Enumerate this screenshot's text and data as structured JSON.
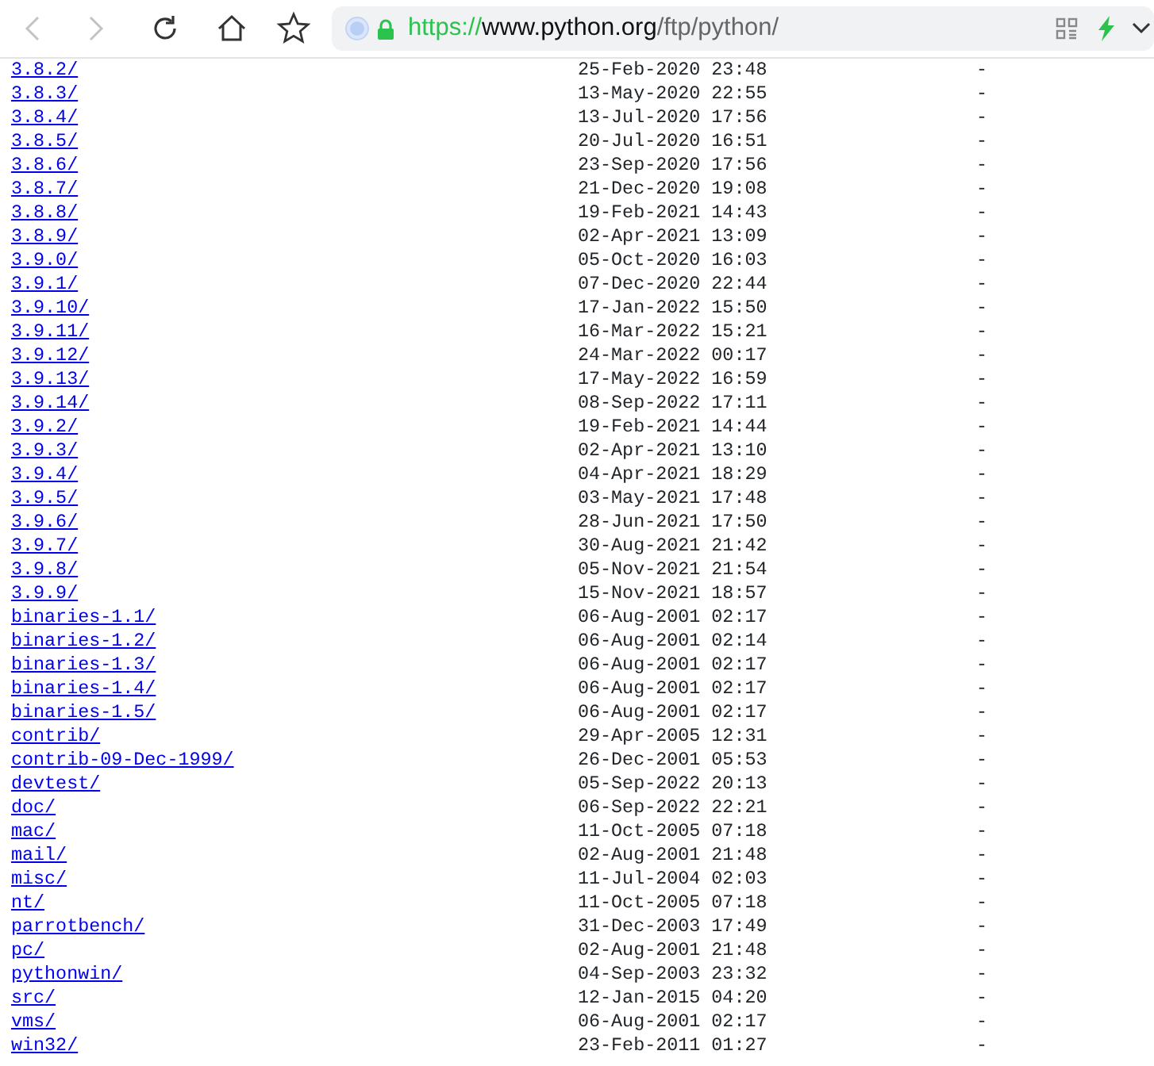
{
  "toolbar": {
    "back_disabled": true,
    "forward_disabled": true
  },
  "address_bar": {
    "scheme": "https://",
    "host": "www.python.org",
    "path": "/ftp/python/"
  },
  "entries": [
    {
      "name": "3.8.2/",
      "modified": "25-Feb-2020 23:48",
      "size": "-"
    },
    {
      "name": "3.8.3/",
      "modified": "13-May-2020 22:55",
      "size": "-"
    },
    {
      "name": "3.8.4/",
      "modified": "13-Jul-2020 17:56",
      "size": "-"
    },
    {
      "name": "3.8.5/",
      "modified": "20-Jul-2020 16:51",
      "size": "-"
    },
    {
      "name": "3.8.6/",
      "modified": "23-Sep-2020 17:56",
      "size": "-"
    },
    {
      "name": "3.8.7/",
      "modified": "21-Dec-2020 19:08",
      "size": "-"
    },
    {
      "name": "3.8.8/",
      "modified": "19-Feb-2021 14:43",
      "size": "-"
    },
    {
      "name": "3.8.9/",
      "modified": "02-Apr-2021 13:09",
      "size": "-"
    },
    {
      "name": "3.9.0/",
      "modified": "05-Oct-2020 16:03",
      "size": "-"
    },
    {
      "name": "3.9.1/",
      "modified": "07-Dec-2020 22:44",
      "size": "-"
    },
    {
      "name": "3.9.10/",
      "modified": "17-Jan-2022 15:50",
      "size": "-"
    },
    {
      "name": "3.9.11/",
      "modified": "16-Mar-2022 15:21",
      "size": "-"
    },
    {
      "name": "3.9.12/",
      "modified": "24-Mar-2022 00:17",
      "size": "-"
    },
    {
      "name": "3.9.13/",
      "modified": "17-May-2022 16:59",
      "size": "-"
    },
    {
      "name": "3.9.14/",
      "modified": "08-Sep-2022 17:11",
      "size": "-"
    },
    {
      "name": "3.9.2/",
      "modified": "19-Feb-2021 14:44",
      "size": "-"
    },
    {
      "name": "3.9.3/",
      "modified": "02-Apr-2021 13:10",
      "size": "-"
    },
    {
      "name": "3.9.4/",
      "modified": "04-Apr-2021 18:29",
      "size": "-"
    },
    {
      "name": "3.9.5/",
      "modified": "03-May-2021 17:48",
      "size": "-"
    },
    {
      "name": "3.9.6/",
      "modified": "28-Jun-2021 17:50",
      "size": "-"
    },
    {
      "name": "3.9.7/",
      "modified": "30-Aug-2021 21:42",
      "size": "-"
    },
    {
      "name": "3.9.8/",
      "modified": "05-Nov-2021 21:54",
      "size": "-"
    },
    {
      "name": "3.9.9/",
      "modified": "15-Nov-2021 18:57",
      "size": "-"
    },
    {
      "name": "binaries-1.1/",
      "modified": "06-Aug-2001 02:17",
      "size": "-"
    },
    {
      "name": "binaries-1.2/",
      "modified": "06-Aug-2001 02:14",
      "size": "-"
    },
    {
      "name": "binaries-1.3/",
      "modified": "06-Aug-2001 02:17",
      "size": "-"
    },
    {
      "name": "binaries-1.4/",
      "modified": "06-Aug-2001 02:17",
      "size": "-"
    },
    {
      "name": "binaries-1.5/",
      "modified": "06-Aug-2001 02:17",
      "size": "-"
    },
    {
      "name": "contrib/",
      "modified": "29-Apr-2005 12:31",
      "size": "-"
    },
    {
      "name": "contrib-09-Dec-1999/",
      "modified": "26-Dec-2001 05:53",
      "size": "-"
    },
    {
      "name": "devtest/",
      "modified": "05-Sep-2022 20:13",
      "size": "-"
    },
    {
      "name": "doc/",
      "modified": "06-Sep-2022 22:21",
      "size": "-"
    },
    {
      "name": "mac/",
      "modified": "11-Oct-2005 07:18",
      "size": "-"
    },
    {
      "name": "mail/",
      "modified": "02-Aug-2001 21:48",
      "size": "-"
    },
    {
      "name": "misc/",
      "modified": "11-Jul-2004 02:03",
      "size": "-"
    },
    {
      "name": "nt/",
      "modified": "11-Oct-2005 07:18",
      "size": "-"
    },
    {
      "name": "parrotbench/",
      "modified": "31-Dec-2003 17:49",
      "size": "-"
    },
    {
      "name": "pc/",
      "modified": "02-Aug-2001 21:48",
      "size": "-"
    },
    {
      "name": "pythonwin/",
      "modified": "04-Sep-2003 23:32",
      "size": "-"
    },
    {
      "name": "src/",
      "modified": "12-Jan-2015 04:20",
      "size": "-"
    },
    {
      "name": "vms/",
      "modified": "06-Aug-2001 02:17",
      "size": "-"
    },
    {
      "name": "win32/",
      "modified": "23-Feb-2011 01:27",
      "size": "-"
    }
  ]
}
